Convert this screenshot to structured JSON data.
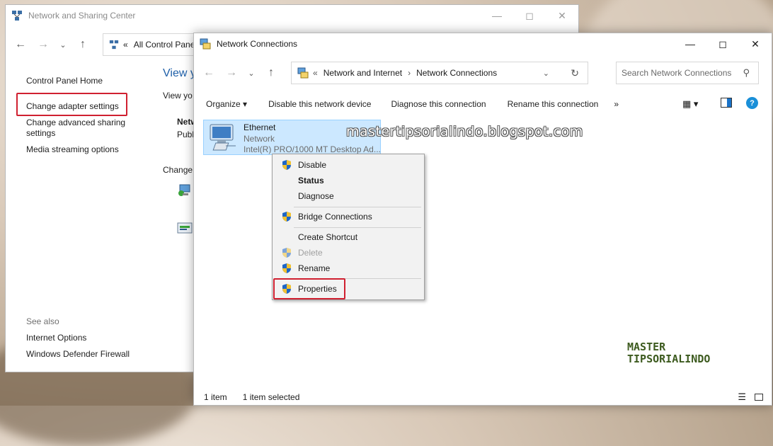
{
  "back_window": {
    "title": "Network and Sharing Center",
    "address_prefix": "«",
    "address_text": "All Control Panel",
    "sidebar": {
      "home": "Control Panel Home",
      "change_adapter": "Change adapter settings",
      "advanced_sharing_line1": "Change advanced sharing",
      "advanced_sharing_line2": "settings",
      "media_streaming": "Media streaming options",
      "see_also": "See also",
      "internet_options": "Internet Options",
      "firewall": "Windows Defender Firewall"
    },
    "main": {
      "heading": "View y",
      "sub": "View yo",
      "netw": "Netw",
      "publ": "Publ",
      "change": "Change"
    }
  },
  "front_window": {
    "title": "Network Connections",
    "breadcrumb": {
      "prefix": "«",
      "part1": "Network and Internet",
      "sep": "›",
      "part2": "Network Connections"
    },
    "search_placeholder": "Search Network Connections",
    "commands": {
      "organize": "Organize ▾",
      "disable": "Disable this network device",
      "diagnose": "Diagnose this connection",
      "rename": "Rename this connection",
      "more": "»"
    },
    "item": {
      "name": "Ethernet",
      "network": "Network",
      "adapter": "Intel(R) PRO/1000 MT Desktop Ad..."
    },
    "status": {
      "count": "1 item",
      "selected": "1 item selected"
    }
  },
  "context_menu": {
    "disable": "Disable",
    "status": "Status",
    "diagnose": "Diagnose",
    "bridge": "Bridge Connections",
    "shortcut": "Create Shortcut",
    "delete": "Delete",
    "rename": "Rename",
    "properties": "Properties"
  },
  "watermark": {
    "url": "mastertipsorialindo.blogspot.com",
    "logo_line1": "MASTER",
    "logo_line2": "TIPSORIALINDO"
  },
  "colors": {
    "highlight": "#cce8ff",
    "red_box": "#d02030",
    "help": "#1a8fd8"
  }
}
